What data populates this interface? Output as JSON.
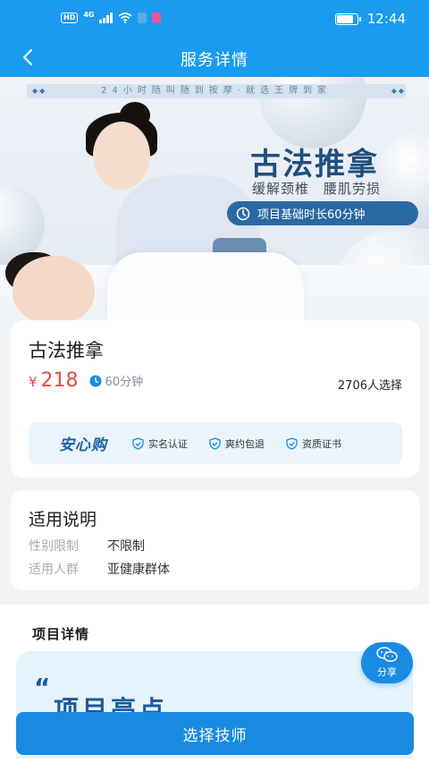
{
  "status_bar": {
    "hd": "HD",
    "network": "4G",
    "time": "12:44",
    "battery_level": 0.85
  },
  "nav": {
    "title": "服务详情"
  },
  "banner": {
    "ticker": "24小时随叫随到按摩·就选王牌到家",
    "headline": "古法推拿",
    "sub1": "缓解颈椎",
    "sub2": "腰肌劳损",
    "pill": "项目基础时长60分钟"
  },
  "service": {
    "name": "古法推拿",
    "currency": "¥",
    "price": "218",
    "duration": "60分钟",
    "chosen": "2706人选择"
  },
  "assurance": {
    "title": "安心购",
    "items": [
      "实名认证",
      "爽约包退",
      "资质证书"
    ]
  },
  "usage": {
    "title": "适用说明",
    "rows": [
      {
        "key": "性别限制",
        "value": "不限制"
      },
      {
        "key": "适用人群",
        "value": "亚健康群体"
      }
    ]
  },
  "details": {
    "title": "项目详情",
    "quote": "“",
    "highlight": "项目亮点"
  },
  "share": {
    "label": "分享"
  },
  "cta": {
    "label": "选择技师"
  },
  "colors": {
    "primary": "#1a9bf0",
    "price": "#e04a4a",
    "assurance": "#1d62a8"
  }
}
